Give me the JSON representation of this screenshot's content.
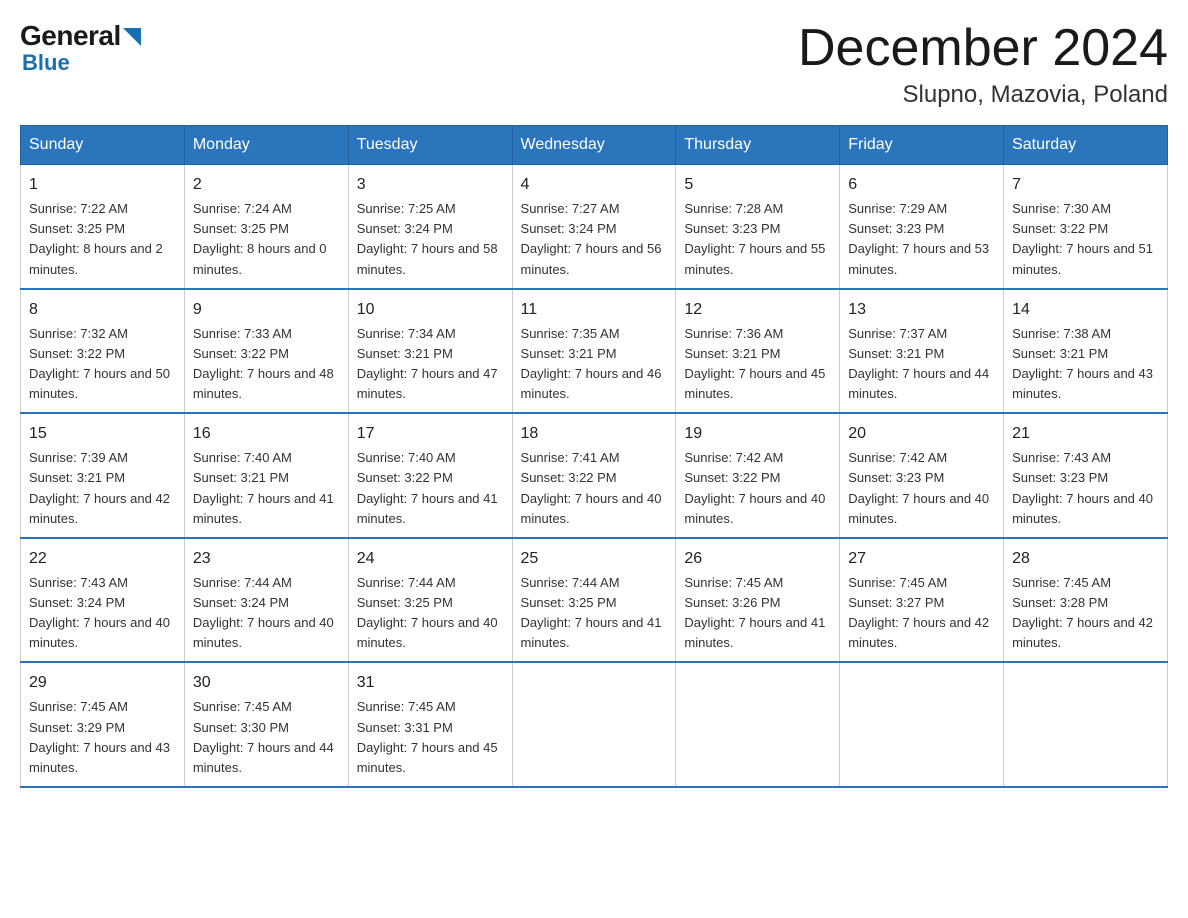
{
  "logo": {
    "general": "General",
    "blue": "Blue"
  },
  "title": "December 2024",
  "subtitle": "Slupno, Mazovia, Poland",
  "headers": [
    "Sunday",
    "Monday",
    "Tuesday",
    "Wednesday",
    "Thursday",
    "Friday",
    "Saturday"
  ],
  "weeks": [
    [
      {
        "day": "1",
        "sunrise": "7:22 AM",
        "sunset": "3:25 PM",
        "daylight": "8 hours and 2 minutes."
      },
      {
        "day": "2",
        "sunrise": "7:24 AM",
        "sunset": "3:25 PM",
        "daylight": "8 hours and 0 minutes."
      },
      {
        "day": "3",
        "sunrise": "7:25 AM",
        "sunset": "3:24 PM",
        "daylight": "7 hours and 58 minutes."
      },
      {
        "day": "4",
        "sunrise": "7:27 AM",
        "sunset": "3:24 PM",
        "daylight": "7 hours and 56 minutes."
      },
      {
        "day": "5",
        "sunrise": "7:28 AM",
        "sunset": "3:23 PM",
        "daylight": "7 hours and 55 minutes."
      },
      {
        "day": "6",
        "sunrise": "7:29 AM",
        "sunset": "3:23 PM",
        "daylight": "7 hours and 53 minutes."
      },
      {
        "day": "7",
        "sunrise": "7:30 AM",
        "sunset": "3:22 PM",
        "daylight": "7 hours and 51 minutes."
      }
    ],
    [
      {
        "day": "8",
        "sunrise": "7:32 AM",
        "sunset": "3:22 PM",
        "daylight": "7 hours and 50 minutes."
      },
      {
        "day": "9",
        "sunrise": "7:33 AM",
        "sunset": "3:22 PM",
        "daylight": "7 hours and 48 minutes."
      },
      {
        "day": "10",
        "sunrise": "7:34 AM",
        "sunset": "3:21 PM",
        "daylight": "7 hours and 47 minutes."
      },
      {
        "day": "11",
        "sunrise": "7:35 AM",
        "sunset": "3:21 PM",
        "daylight": "7 hours and 46 minutes."
      },
      {
        "day": "12",
        "sunrise": "7:36 AM",
        "sunset": "3:21 PM",
        "daylight": "7 hours and 45 minutes."
      },
      {
        "day": "13",
        "sunrise": "7:37 AM",
        "sunset": "3:21 PM",
        "daylight": "7 hours and 44 minutes."
      },
      {
        "day": "14",
        "sunrise": "7:38 AM",
        "sunset": "3:21 PM",
        "daylight": "7 hours and 43 minutes."
      }
    ],
    [
      {
        "day": "15",
        "sunrise": "7:39 AM",
        "sunset": "3:21 PM",
        "daylight": "7 hours and 42 minutes."
      },
      {
        "day": "16",
        "sunrise": "7:40 AM",
        "sunset": "3:21 PM",
        "daylight": "7 hours and 41 minutes."
      },
      {
        "day": "17",
        "sunrise": "7:40 AM",
        "sunset": "3:22 PM",
        "daylight": "7 hours and 41 minutes."
      },
      {
        "day": "18",
        "sunrise": "7:41 AM",
        "sunset": "3:22 PM",
        "daylight": "7 hours and 40 minutes."
      },
      {
        "day": "19",
        "sunrise": "7:42 AM",
        "sunset": "3:22 PM",
        "daylight": "7 hours and 40 minutes."
      },
      {
        "day": "20",
        "sunrise": "7:42 AM",
        "sunset": "3:23 PM",
        "daylight": "7 hours and 40 minutes."
      },
      {
        "day": "21",
        "sunrise": "7:43 AM",
        "sunset": "3:23 PM",
        "daylight": "7 hours and 40 minutes."
      }
    ],
    [
      {
        "day": "22",
        "sunrise": "7:43 AM",
        "sunset": "3:24 PM",
        "daylight": "7 hours and 40 minutes."
      },
      {
        "day": "23",
        "sunrise": "7:44 AM",
        "sunset": "3:24 PM",
        "daylight": "7 hours and 40 minutes."
      },
      {
        "day": "24",
        "sunrise": "7:44 AM",
        "sunset": "3:25 PM",
        "daylight": "7 hours and 40 minutes."
      },
      {
        "day": "25",
        "sunrise": "7:44 AM",
        "sunset": "3:25 PM",
        "daylight": "7 hours and 41 minutes."
      },
      {
        "day": "26",
        "sunrise": "7:45 AM",
        "sunset": "3:26 PM",
        "daylight": "7 hours and 41 minutes."
      },
      {
        "day": "27",
        "sunrise": "7:45 AM",
        "sunset": "3:27 PM",
        "daylight": "7 hours and 42 minutes."
      },
      {
        "day": "28",
        "sunrise": "7:45 AM",
        "sunset": "3:28 PM",
        "daylight": "7 hours and 42 minutes."
      }
    ],
    [
      {
        "day": "29",
        "sunrise": "7:45 AM",
        "sunset": "3:29 PM",
        "daylight": "7 hours and 43 minutes."
      },
      {
        "day": "30",
        "sunrise": "7:45 AM",
        "sunset": "3:30 PM",
        "daylight": "7 hours and 44 minutes."
      },
      {
        "day": "31",
        "sunrise": "7:45 AM",
        "sunset": "3:31 PM",
        "daylight": "7 hours and 45 minutes."
      },
      null,
      null,
      null,
      null
    ]
  ],
  "labels": {
    "sunrise": "Sunrise:",
    "sunset": "Sunset:",
    "daylight": "Daylight:"
  }
}
